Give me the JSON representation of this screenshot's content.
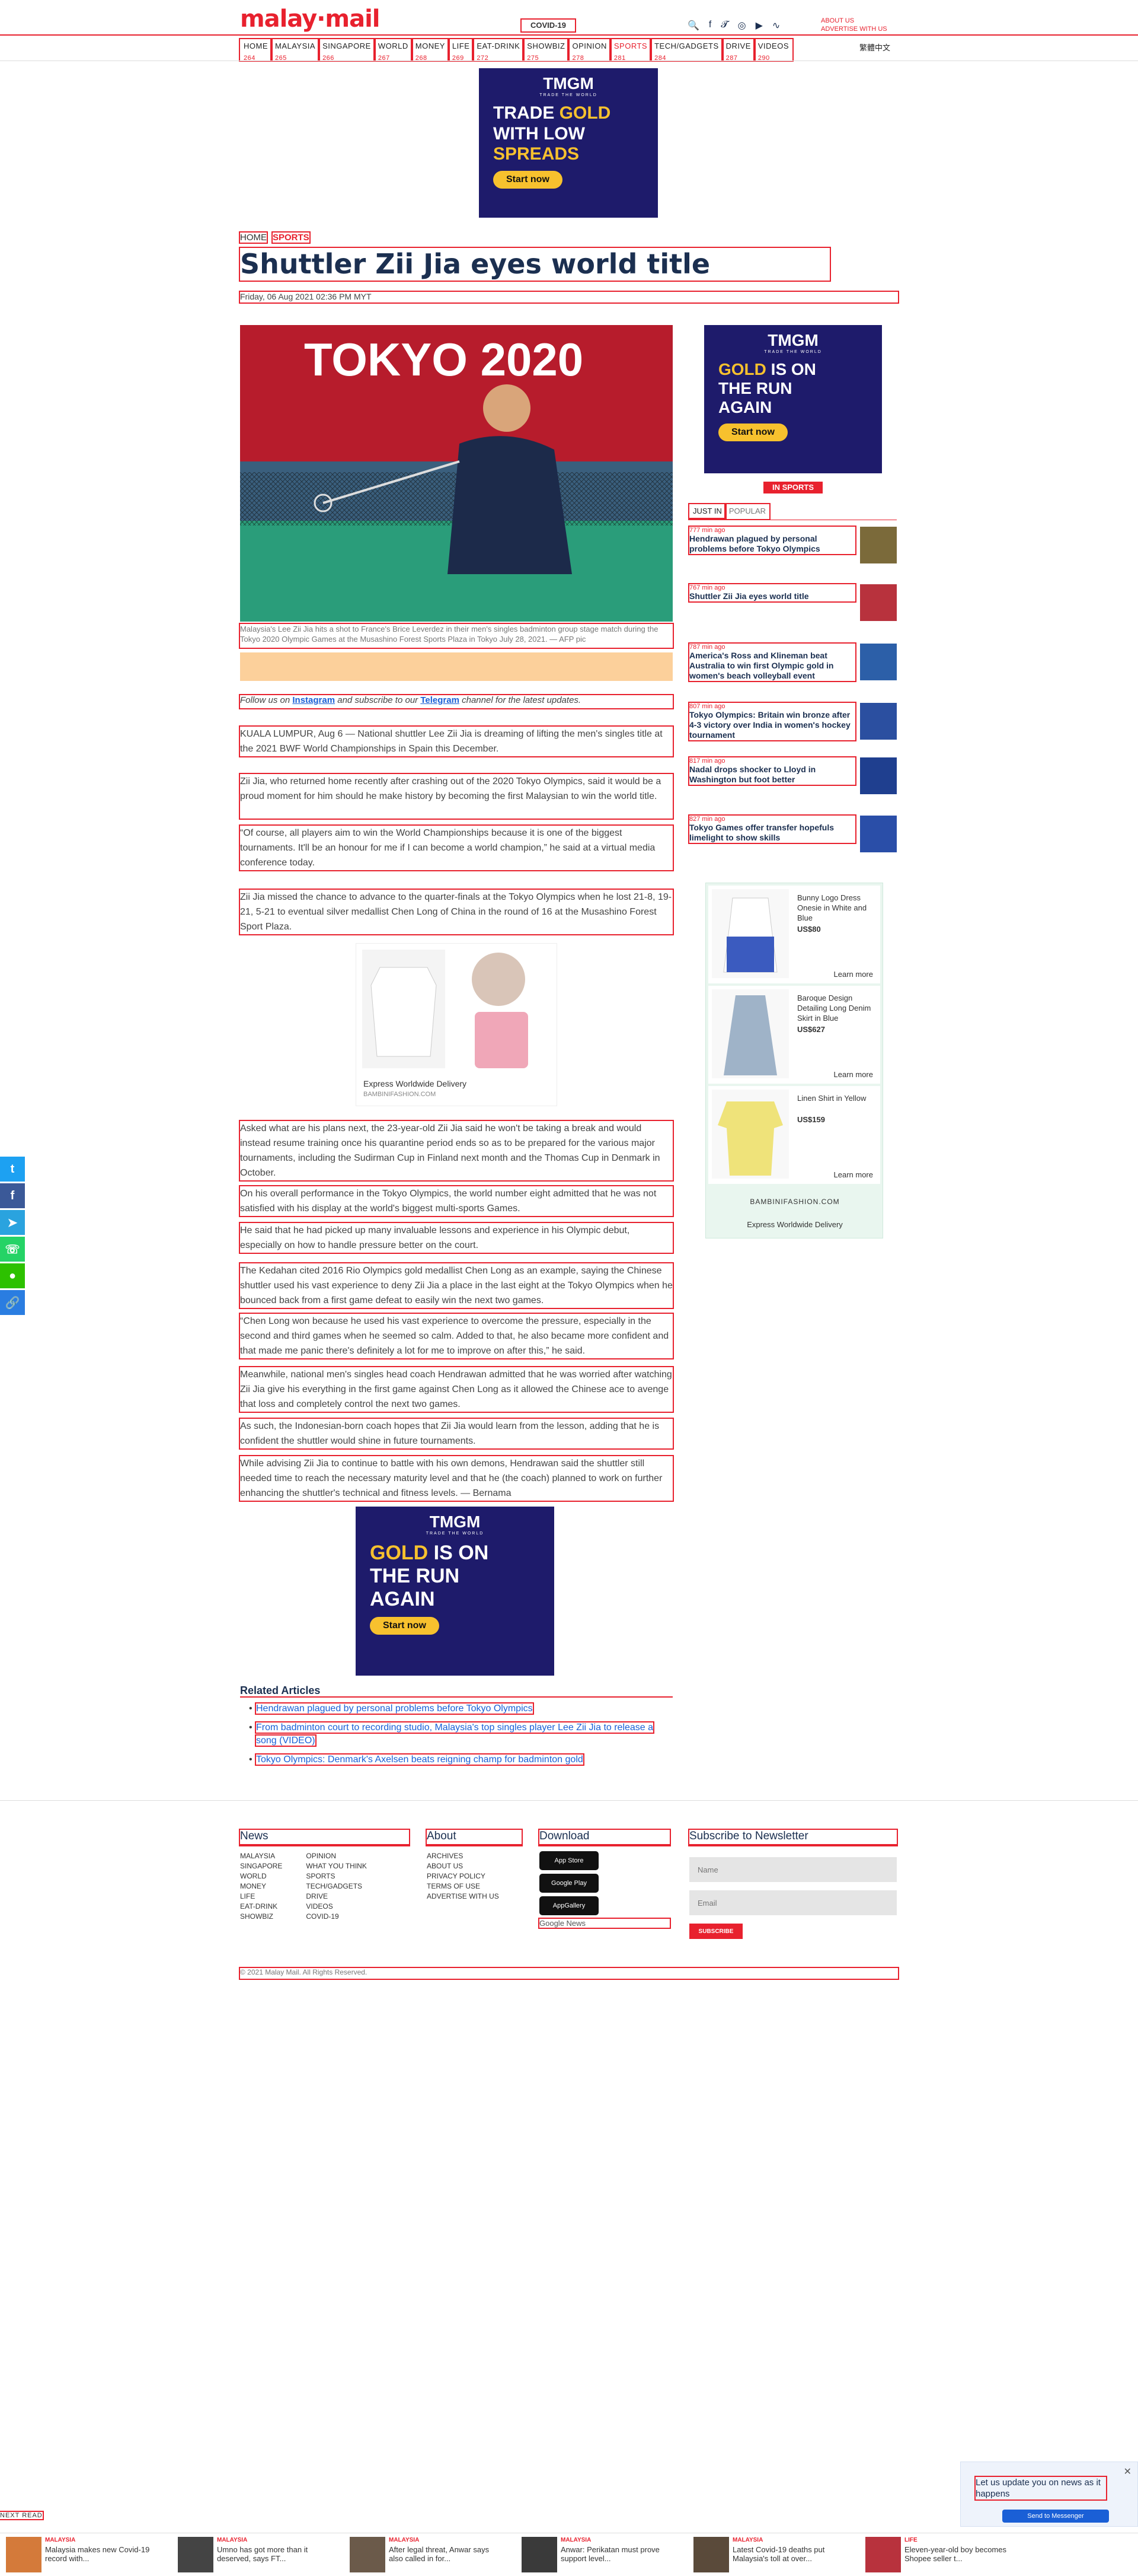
{
  "header": {
    "logo": "malay·mail",
    "covid_label": "COVID-19",
    "top_right": [
      "ABOUT US",
      "ADVERTISE WITH US"
    ],
    "social_icons": [
      "search-icon",
      "facebook-icon",
      "twitter-icon",
      "instagram-icon",
      "youtube-icon",
      "rss-icon"
    ],
    "nav": [
      {
        "label": "HOME",
        "num": "264"
      },
      {
        "label": "MALAYSIA",
        "num": "265"
      },
      {
        "label": "SINGAPORE",
        "num": "266"
      },
      {
        "label": "WORLD",
        "num": "267"
      },
      {
        "label": "MONEY",
        "num": "268"
      },
      {
        "label": "LIFE",
        "num": "269"
      },
      {
        "label": "EAT-DRINK",
        "num": "272"
      },
      {
        "label": "SHOWBIZ",
        "num": "275"
      },
      {
        "label": "OPINION",
        "num": "278"
      },
      {
        "label": "SPORTS",
        "num": "281"
      },
      {
        "label": "TECH/GADGETS",
        "num": "284"
      },
      {
        "label": "DRIVE",
        "num": "287"
      },
      {
        "label": "VIDEOS",
        "num": "290"
      }
    ],
    "nav_right": "繁體中文"
  },
  "top_ad": {
    "brand": "TMGM",
    "brand_sub": "TRADE THE WORLD",
    "line1a": "TRADE ",
    "line1b": "GOLD",
    "line2": "WITH LOW",
    "line3": "SPREADS",
    "cta": "Start now"
  },
  "article": {
    "breadcrumb_home": "HOME",
    "breadcrumb_section": "SPORTS",
    "title": "Shuttler Zii Jia eyes world title",
    "date": "Friday, 06 Aug 2021 02:36 PM MYT",
    "hero_overlay": "TOKYO 2020",
    "caption": "Malaysia's Lee Zii Jia hits a shot to France's Brice Leverdez in their men's singles badminton group stage match during the Tokyo 2020 Olympic Games at the Musashino Forest Sports Plaza in Tokyo July 28, 2021. — AFP pic",
    "follow_prefix": "Follow us on ",
    "follow_ig": "Instagram",
    "follow_mid": " and subscribe to our ",
    "follow_tg": "Telegram",
    "follow_suffix": " channel for the latest updates.",
    "paragraphs_a": [
      "KUALA LUMPUR, Aug 6 — National shuttler Lee Zii Jia is dreaming of lifting the men's singles title at the 2021 BWF World Championships in Spain this December.",
      "Zii Jia, who returned home recently after crashing out of the 2020 Tokyo Olympics, said it would be a proud moment for him should he make history by becoming the first Malaysian to win the world title.",
      "“Of course, all players aim to win the World Championships because it is one of the biggest tournaments. It'll be an honour for me if I can become a world champion,” he said at a virtual media conference today.",
      "Zii Jia missed the chance to advance to the quarter-finals at the Tokyo Olympics when he lost 21-8, 19-21, 5-21 to eventual silver medallist Chen Long of China in the round of 16 at the Musashino Forest Sport Plaza."
    ],
    "paragraphs_b": [
      "Asked what are his plans next, the 23-year-old Zii Jia said he won't be taking a break and would instead resume training once his quarantine period ends so as to be prepared for the various major tournaments, including the Sudirman Cup in Finland next month and the Thomas Cup in Denmark in October.",
      "On his overall performance in the Tokyo Olympics, the world number eight admitted that he was not satisfied with his display at the world's biggest multi-sports Games.",
      "He said that he had picked up many invaluable lessons and experience in his Olympic debut, especially on how to handle pressure better on the court.",
      "The Kedahan cited 2016 Rio Olympics gold medallist Chen Long as an example, saying the Chinese shuttler used his vast experience to deny Zii Jia a place in the last eight at the Tokyo Olympics when he bounced back from a first game defeat to easily win the next two games.",
      "“Chen Long won because he used his vast experience to overcome the pressure, especially in the second and third games when he seemed so calm. Added to that, he also became more confident and that made me panic there's definitely a lot for me to improve on after this,” he said.",
      "Meanwhile, national men's singles head coach Hendrawan admitted that he was worried after watching Zii Jia give his everything in the first game against Chen Long as it allowed the Chinese ace to avenge that loss and completely control the next two games.",
      "As such, the Indonesian-born coach hopes that Zii Jia would learn from the lesson, adding that he is confident the shuttler would shine in future tournaments.",
      "While advising Zii Jia to continue to battle with his own demons, Hendrawan said the shuttler still needed time to reach the necessary maturity level and that he (the coach) planned to work on further enhancing the shuttler's technical and fitness levels. — Bernama"
    ]
  },
  "inline_ad": {
    "label": "Express Worldwide Delivery",
    "domain": "BAMBINIFASHION.COM"
  },
  "sidebar": {
    "ad": {
      "brand": "TMGM",
      "brand_sub": "TRADE THE WORLD",
      "l1a": "GOLD ",
      "l1b": "IS ON",
      "l2": "THE RUN",
      "l3": "AGAIN",
      "cta": "Start now"
    },
    "section_badge": "IN SPORTS",
    "tabs": [
      "JUST IN",
      "POPULAR"
    ],
    "items": [
      {
        "time": "777 min ago",
        "headline": "Hendrawan plagued by personal problems before Tokyo Olympics"
      },
      {
        "time": "767 min ago",
        "headline": "Shuttler Zii Jia eyes world title"
      },
      {
        "time": "787 min ago",
        "headline": "America's Ross and Klineman beat Australia to win first Olympic gold in women's beach volleyball event"
      },
      {
        "time": "807 min ago",
        "headline": "Tokyo Olympics: Britain win bronze after 4-3 victory over India in women's hockey tournament"
      },
      {
        "time": "817 min ago",
        "headline": "Nadal drops shocker to Lloyd in Washington but foot better"
      },
      {
        "time": "827 min ago",
        "headline": "Tokyo Games offer transfer hopefuls limelight to show skills"
      }
    ],
    "shop": {
      "products": [
        {
          "name": "Bunny Logo Dress Onesie in White and Blue",
          "price": "US$80"
        },
        {
          "name": "Baroque Design Detailing Long Denim Skirt in Blue",
          "price": "US$627"
        },
        {
          "name": "Linen Shirt in Yellow",
          "price": "US$159"
        }
      ],
      "learn_more": "Learn more",
      "domain": "BAMBINIFASHION.COM",
      "delivery": "Express Worldwide Delivery"
    }
  },
  "bottom_ad": {
    "brand": "TMGM",
    "brand_sub": "TRADE THE WORLD",
    "l1a": "GOLD ",
    "l1b": "IS ON",
    "l2": "THE RUN",
    "l3": "AGAIN",
    "cta": "Start now"
  },
  "related": {
    "title": "Related Articles",
    "items": [
      "Hendrawan plagued by personal problems before Tokyo Olympics",
      "From badminton court to recording studio, Malaysia's top singles player Lee Zii Jia to release a song (VIDEO)",
      "Tokyo Olympics: Denmark's Axelsen beats reigning champ for badminton gold"
    ]
  },
  "footer": {
    "news_title": "News",
    "news_col1": [
      "MALAYSIA",
      "SINGAPORE",
      "WORLD",
      "MONEY",
      "LIFE",
      "EAT-DRINK",
      "SHOWBIZ"
    ],
    "news_col2": [
      "OPINION",
      "WHAT YOU THINK",
      "SPORTS",
      "TECH/GADGETS",
      "DRIVE",
      "VIDEOS",
      "COVID-19"
    ],
    "about_title": "About",
    "about_links": [
      "ARCHIVES",
      "ABOUT US",
      "PRIVACY POLICY",
      "TERMS OF USE",
      "ADVERTISE WITH US"
    ],
    "download_title": "Download",
    "stores": [
      "App Store",
      "Google Play",
      "AppGallery"
    ],
    "google_news": "Google News",
    "newsletter_title": "Subscribe to Newsletter",
    "name_placeholder": "Name",
    "email_placeholder": "Email",
    "subscribe": "SUBSCRIBE",
    "copyright": "© 2021 Malay Mail. All Rights Reserved."
  },
  "notify": {
    "message": "Let us update you on news as it happens",
    "button": "Send to Messenger"
  },
  "next_read": "NEXT READ",
  "ticker": [
    {
      "cat": "MALAYSIA",
      "headline": "Malaysia makes new Covid-19 record with..."
    },
    {
      "cat": "MALAYSIA",
      "headline": "Umno has got more than it deserved, says FT..."
    },
    {
      "cat": "MALAYSIA",
      "headline": "After legal threat, Anwar says also called in for..."
    },
    {
      "cat": "MALAYSIA",
      "headline": "Anwar: Perikatan must prove support level..."
    },
    {
      "cat": "MALAYSIA",
      "headline": "Latest Covid-19 deaths put Malaysia's toll at over..."
    },
    {
      "cat": "LIFE",
      "headline": "Eleven-year-old boy becomes Shopee seller t..."
    }
  ],
  "colors": {
    "accent": "#e8212e",
    "navy": "#1b2f50",
    "ad_bg": "#1e1b6b",
    "gold": "#f7c12e"
  }
}
